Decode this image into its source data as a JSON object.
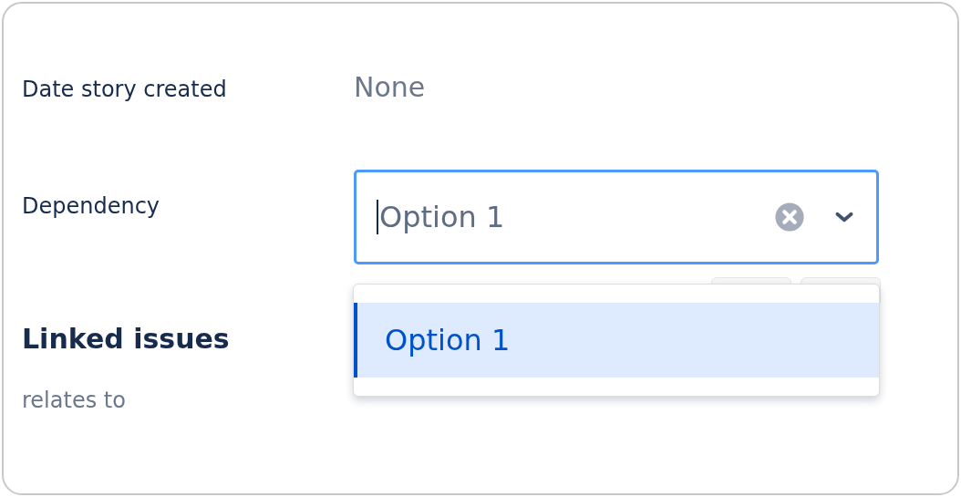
{
  "fields": [
    {
      "label": "Date story created",
      "kind": "text",
      "value": "None"
    },
    {
      "label": "Dependency",
      "kind": "select",
      "value": "Option 1",
      "focused": true,
      "options": [
        {
          "label": "Option 1",
          "selected": true
        }
      ]
    }
  ],
  "linked_issues": {
    "title": "Linked issues",
    "relation": "relates to"
  }
}
